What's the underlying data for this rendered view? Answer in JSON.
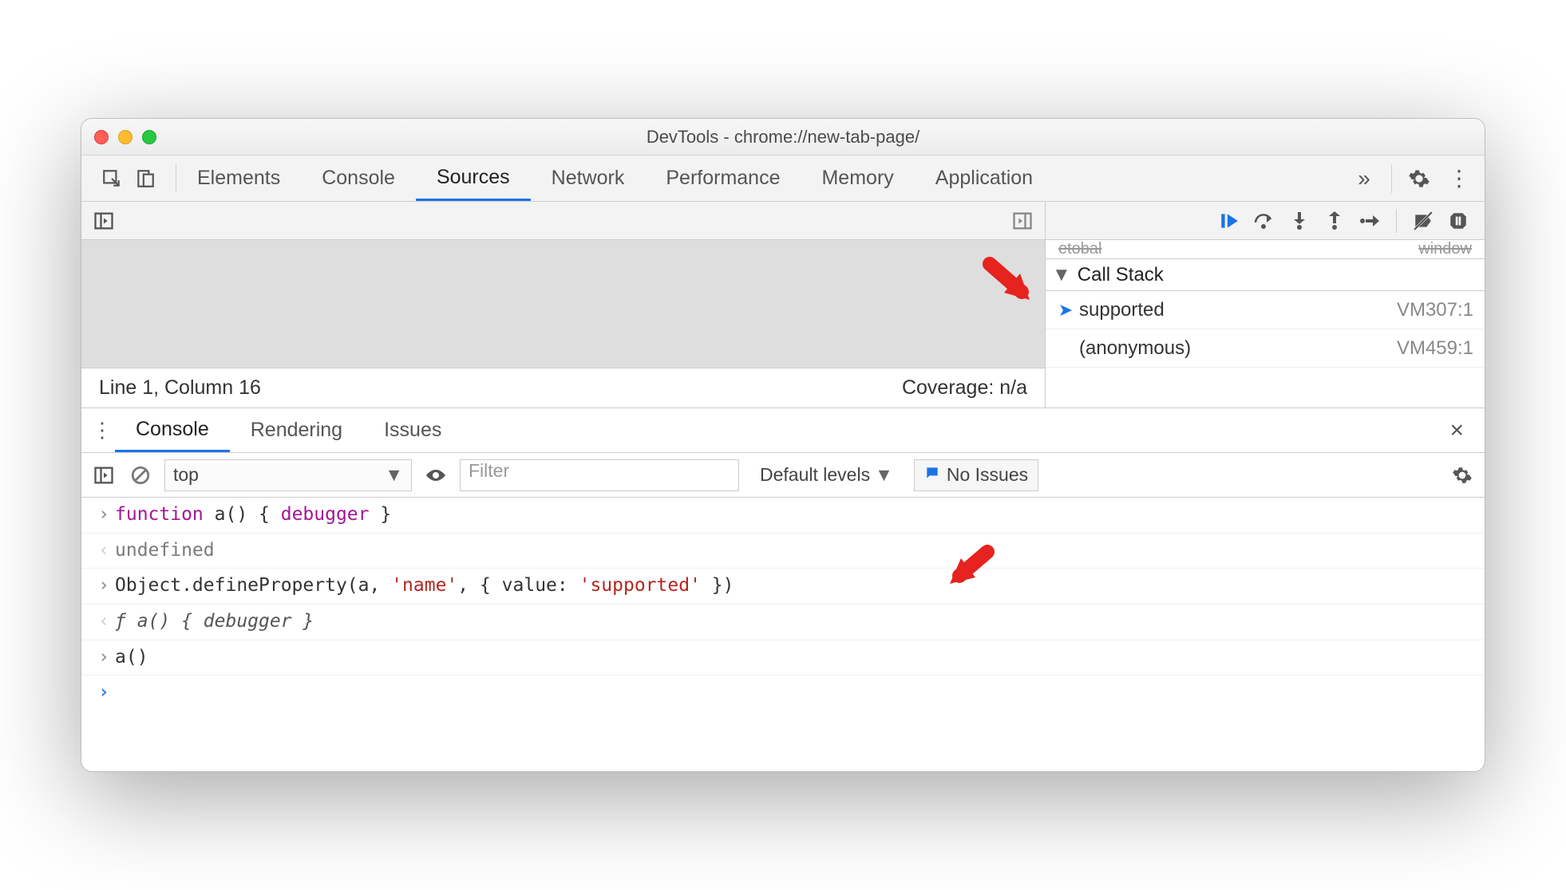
{
  "window": {
    "title": "DevTools - chrome://new-tab-page/"
  },
  "mainTabs": {
    "items": [
      "Elements",
      "Console",
      "Sources",
      "Network",
      "Performance",
      "Memory",
      "Application"
    ],
    "activeIndex": 2
  },
  "sources": {
    "status": {
      "position": "Line 1, Column 16",
      "coverage": "Coverage: n/a"
    }
  },
  "debugger": {
    "hiddenRow": {
      "left": "etobal",
      "right": "window"
    },
    "callStack": {
      "header": "Call Stack",
      "frames": [
        {
          "name": "supported",
          "location": "VM307:1",
          "current": true
        },
        {
          "name": "(anonymous)",
          "location": "VM459:1",
          "current": false
        }
      ]
    }
  },
  "drawer": {
    "tabs": [
      "Console",
      "Rendering",
      "Issues"
    ],
    "activeIndex": 0
  },
  "consoleBar": {
    "context": "top",
    "filterPlaceholder": "Filter",
    "levels": "Default levels",
    "issues": "No Issues"
  },
  "consoleLog": {
    "l0": {
      "kind": "input",
      "parts": [
        "function",
        " a() { ",
        "debugger",
        " }"
      ]
    },
    "l1": {
      "kind": "return",
      "text": "undefined"
    },
    "l2": {
      "kind": "input",
      "parts": [
        "Object.defineProperty(a, ",
        "'name'",
        ", { value: ",
        "'supported'",
        " })"
      ]
    },
    "l3": {
      "kind": "return-italic",
      "prefix": "ƒ ",
      "text": "a() { debugger }"
    },
    "l4": {
      "kind": "input",
      "text": "a()"
    }
  }
}
